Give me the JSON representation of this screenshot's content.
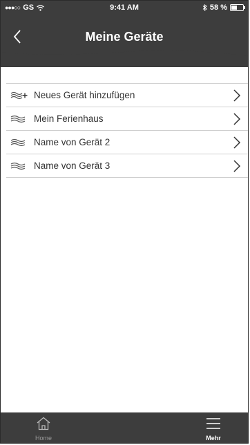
{
  "status_bar": {
    "carrier": "GS",
    "time": "9:41 AM",
    "battery": "58 %",
    "battery_level": 0.58
  },
  "header": {
    "title": "Meine Geräte"
  },
  "devices": {
    "items": [
      {
        "label": "Neues Gerät hinzufügen",
        "icon": "add-device-icon"
      },
      {
        "label": "Mein Ferienhaus",
        "icon": "device-wave-icon"
      },
      {
        "label": "Name von Gerät 2",
        "icon": "device-wave-icon"
      },
      {
        "label": "Name von Gerät 3",
        "icon": "device-wave-icon"
      }
    ]
  },
  "tabbar": {
    "home_label": "Home",
    "more_label": "Mehr"
  },
  "colors": {
    "header_bg": "#3d3d3d",
    "divider": "#cfcfcf",
    "text": "#333333"
  }
}
